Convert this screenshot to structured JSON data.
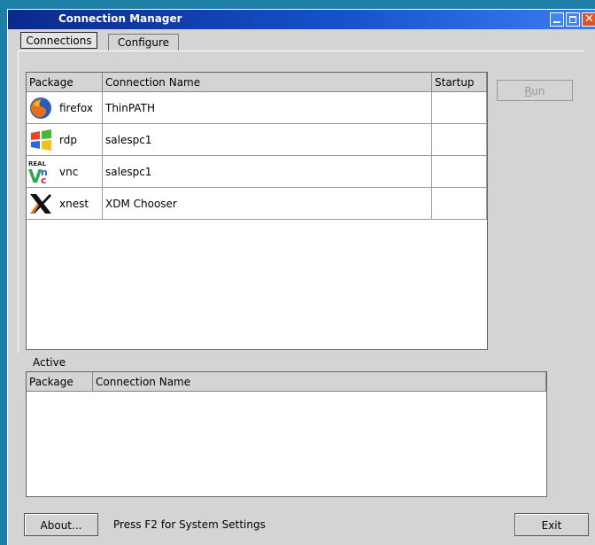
{
  "window": {
    "title": "Connection Manager"
  },
  "tabs": [
    {
      "label": "Connections",
      "active": true
    },
    {
      "label": "Configure",
      "active": false
    }
  ],
  "connections": {
    "columns": [
      "Package",
      "Connection Name",
      "Startup"
    ],
    "rows": [
      {
        "package": "firefox",
        "icon": "firefox-icon",
        "name": "ThinPATH",
        "startup": ""
      },
      {
        "package": "rdp",
        "icon": "windows-icon",
        "name": "salespc1",
        "startup": ""
      },
      {
        "package": "vnc",
        "icon": "realvnc-icon",
        "name": "salespc1",
        "startup": ""
      },
      {
        "package": "xnest",
        "icon": "x-window-icon",
        "name": "XDM Chooser",
        "startup": ""
      }
    ]
  },
  "run_button": {
    "label_underlined": "R",
    "label_rest": "un",
    "enabled": false
  },
  "active": {
    "label": "Active",
    "columns": [
      "Package",
      "Connection Name"
    ]
  },
  "footer": {
    "about_label": "About...",
    "status_text": "Press F2 for System Settings",
    "exit_label": "Exit"
  },
  "colors": {
    "desktop": "#1e7fa6",
    "titlebar": "#1650c8",
    "window": "#d4d4d4"
  }
}
